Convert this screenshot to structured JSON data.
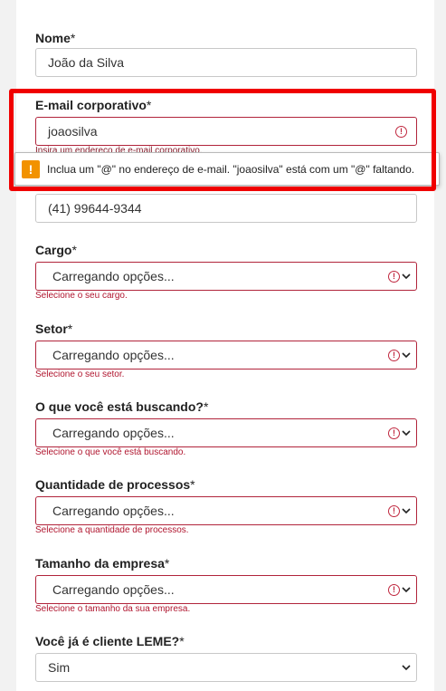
{
  "form": {
    "nome": {
      "label": "Nome",
      "required": "*",
      "value": "João da Silva"
    },
    "email": {
      "label": "E-mail corporativo",
      "required": "*",
      "value": "joaosilva",
      "hint": "Insira um endereço de e-mail corporativo."
    },
    "phone": {
      "value": "(41) 99644-9344"
    },
    "cargo": {
      "label": "Cargo",
      "required": "*",
      "value": "Carregando opções...",
      "error": "Selecione o seu cargo."
    },
    "setor": {
      "label": "Setor",
      "required": "*",
      "value": "Carregando opções...",
      "error": "Selecione o seu setor."
    },
    "buscando": {
      "label": "O que você está buscando?",
      "required": "*",
      "value": "Carregando opções...",
      "error": "Selecione o que você está buscando."
    },
    "processos": {
      "label": "Quantidade de processos",
      "required": "*",
      "value": "Carregando opções...",
      "error": "Selecione a quantidade de processos."
    },
    "tamanho": {
      "label": "Tamanho da empresa",
      "required": "*",
      "value": "Carregando opções...",
      "error": "Selecione o tamanho da sua empresa."
    },
    "cliente": {
      "label": "Você já é cliente LEME?",
      "required": "*",
      "value": "Sim"
    }
  },
  "tooltip": {
    "icon": "!",
    "text": "Inclua um \"@\" no endereço de e-mail. \"joaosilva\" está com um \"@\" faltando."
  },
  "icons": {
    "invalid": "!",
    "warning": "warning-icon",
    "chevron": "chevron-down-icon"
  },
  "colors": {
    "error": "#b0162f",
    "highlight": "#f00000",
    "warning": "#f29200"
  }
}
